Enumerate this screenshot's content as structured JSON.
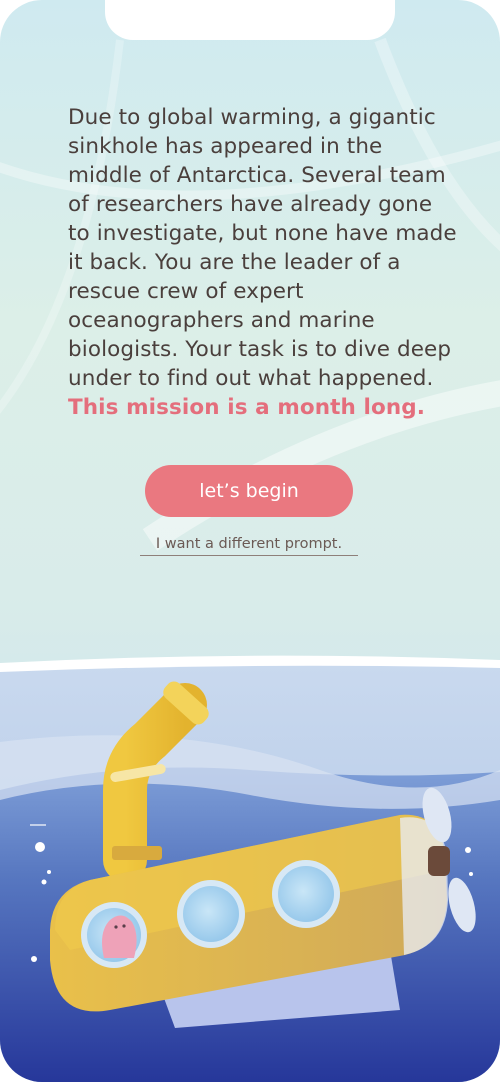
{
  "story": {
    "text": "Due to global warming, a gigantic sinkhole has appeared in the middle of Antarctica. Several team of researchers have already gone to investigate, but none have made it back. You are the leader of a rescue crew of expert oceanographers and marine biologists. Your task is to dive deep under to find out what happened.",
    "highlight": "This mission is a month long."
  },
  "actions": {
    "begin_label": "let’s begin",
    "alt_prompt_label": "I want a different prompt."
  },
  "illustration": {
    "icon": "submarine-illustration",
    "colors": {
      "button": "#ea7880",
      "highlight": "#e46e7c",
      "submarine": "#e8c24a",
      "ocean_deep": "#2f3f9a"
    }
  }
}
